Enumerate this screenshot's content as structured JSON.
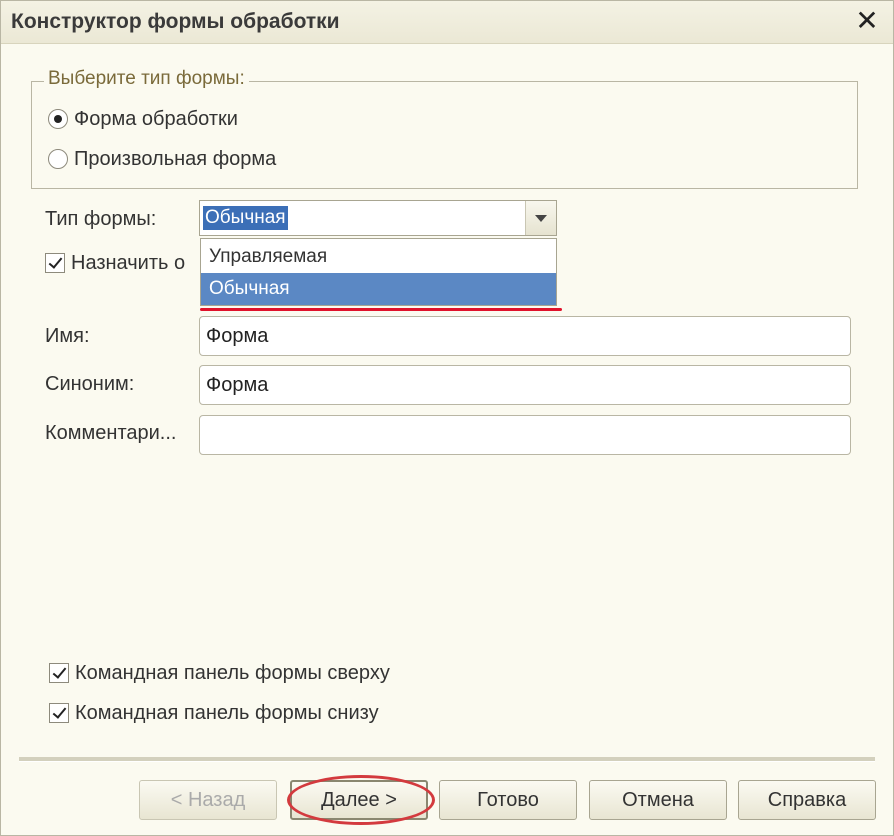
{
  "window": {
    "title": "Конструктор формы обработки"
  },
  "form_type_group": {
    "legend": "Выберите тип формы:",
    "options": [
      {
        "label": "Форма обработки",
        "checked": true
      },
      {
        "label": "Произвольная форма",
        "checked": false
      }
    ]
  },
  "form_kind": {
    "label": "Тип формы:",
    "value": "Обычная",
    "options": [
      "Управляемая",
      "Обычная"
    ],
    "selected_index": 1
  },
  "assign": {
    "label": "Назначить о",
    "checked": true
  },
  "fields": {
    "name": {
      "label": "Имя:",
      "value": "Форма"
    },
    "synonym": {
      "label": "Синоним:",
      "value": "Форма"
    },
    "comment": {
      "label": "Комментари...",
      "value": ""
    }
  },
  "options": {
    "panel_top": {
      "label": "Командная панель формы сверху",
      "checked": true
    },
    "panel_bottom": {
      "label": "Командная панель формы снизу",
      "checked": true
    }
  },
  "buttons": {
    "back": "< Назад",
    "next": "Далее >",
    "done": "Готово",
    "cancel": "Отмена",
    "help": "Справка"
  },
  "annotation_color": "#e0112a"
}
